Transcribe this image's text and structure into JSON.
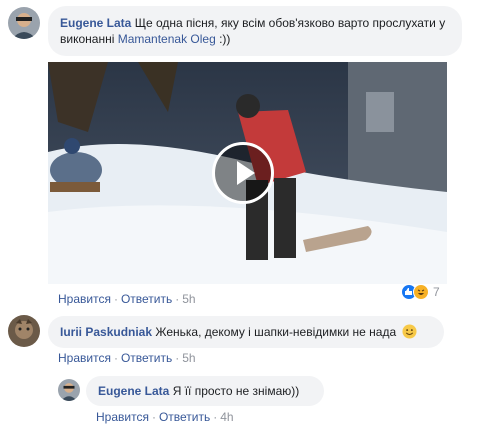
{
  "comments": [
    {
      "author": "Eugene Lata",
      "text": "Ще одна пісня, яку всім обов'язково варто прослухати у виконанні",
      "mention": "Mamantenak Oleg",
      "suffix": " :))",
      "actions": {
        "like": "Нравится",
        "reply": "Ответить",
        "time": "5h"
      },
      "reaction_count": "7"
    },
    {
      "author": "Iurii Paskudniak",
      "text": "Женька, декому і шапки-невідимки не нада",
      "actions": {
        "like": "Нравится",
        "reply": "Ответить",
        "time": "5h"
      }
    }
  ],
  "reply": {
    "author": "Eugene Lata",
    "text": "Я її просто не знімаю))",
    "actions": {
      "like": "Нравится",
      "reply": "Ответить",
      "time": "4h"
    }
  },
  "colors": {
    "link": "#385898",
    "bubble": "#f2f3f5",
    "meta": "#90949c",
    "like_blue": "#1877f2",
    "haha_yellow": "#f7b125"
  },
  "icons": [
    "play-icon",
    "like-reaction-icon",
    "haha-reaction-icon",
    "smile-emoji-icon"
  ]
}
